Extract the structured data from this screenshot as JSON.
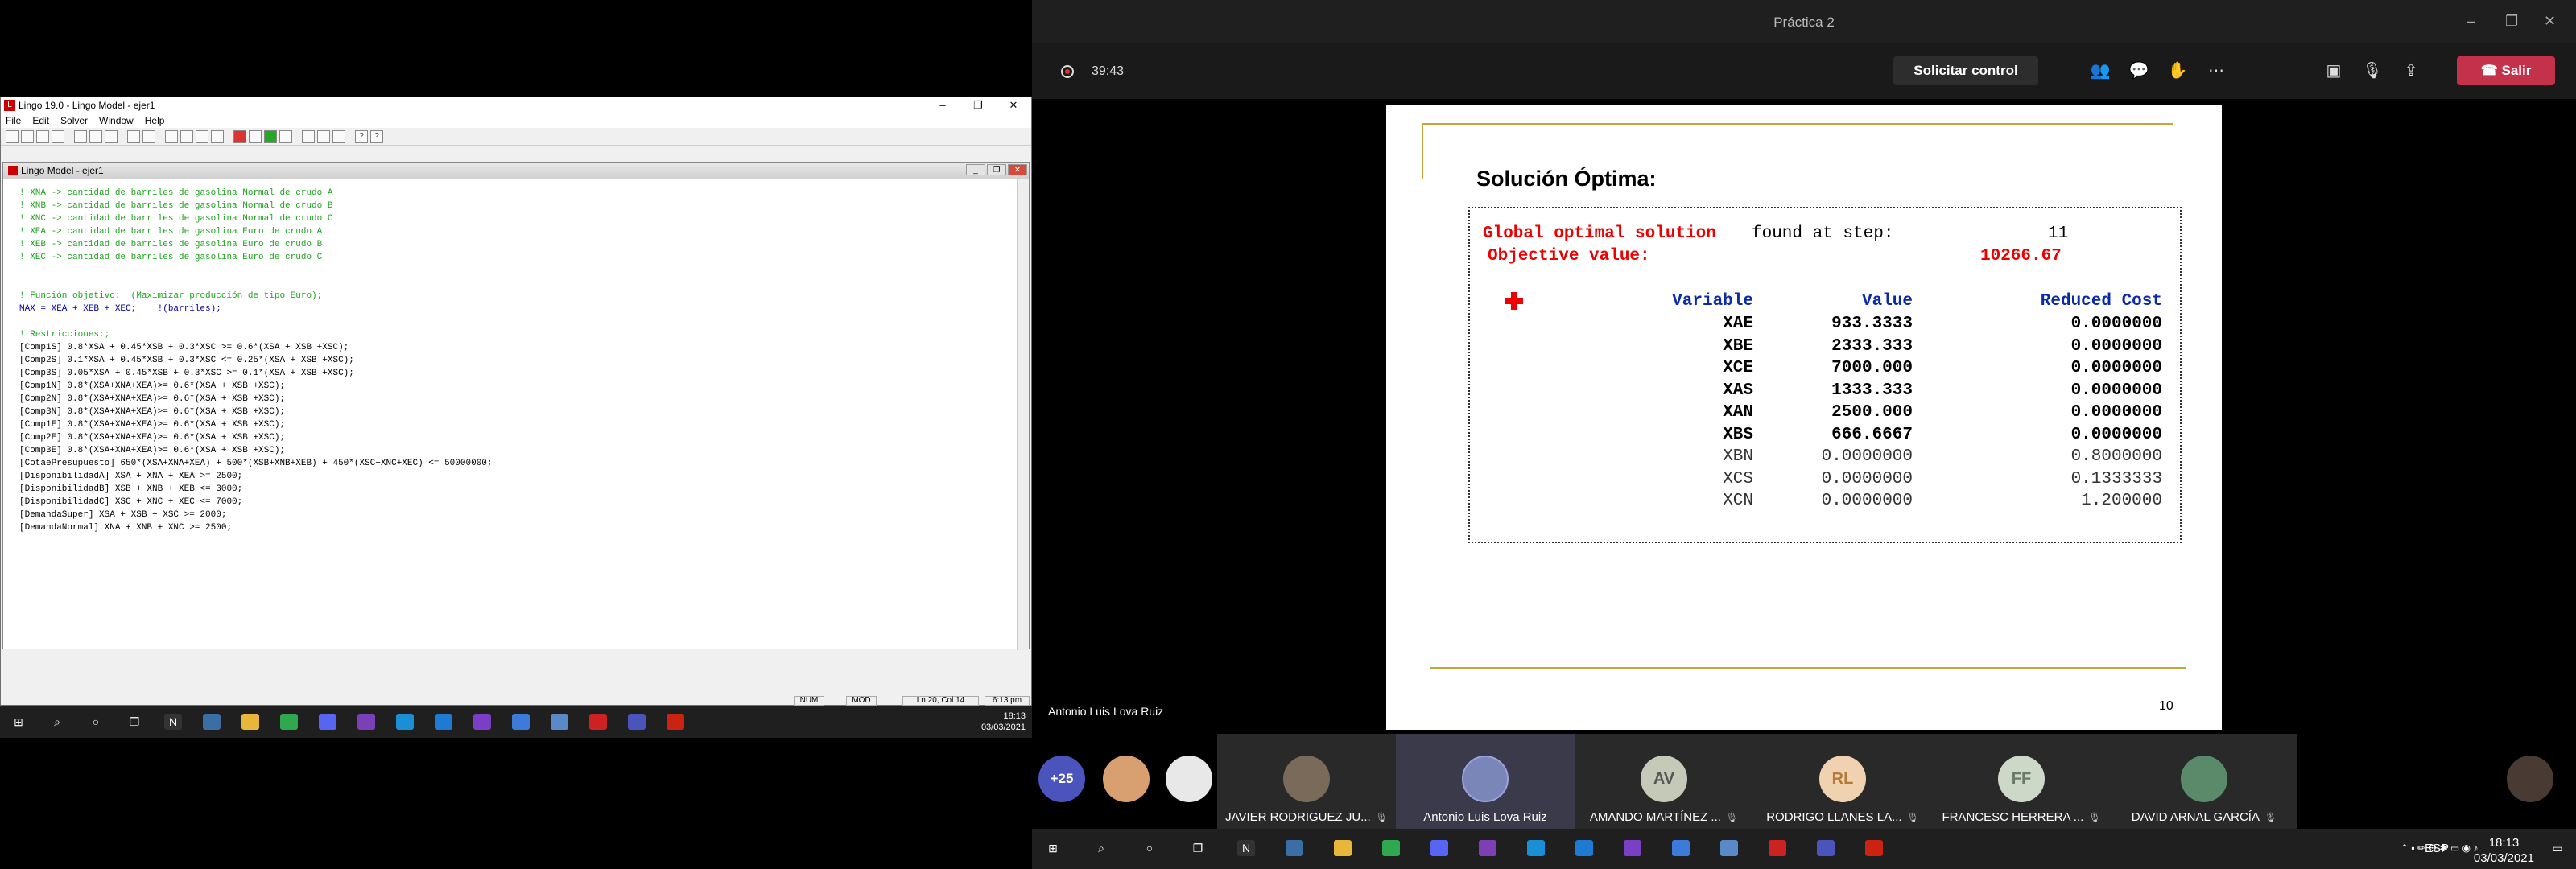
{
  "lingo": {
    "title": "Lingo 19.0 - Lingo Model - ejer1",
    "menu": [
      "File",
      "Edit",
      "Solver",
      "Window",
      "Help"
    ],
    "model_title": "Lingo Model - ejer1",
    "code_lines": [
      {
        "type": "comment",
        "text": "! XNA -> cantidad de barriles de gasolina Normal de crudo A"
      },
      {
        "type": "comment",
        "text": "! XNB -> cantidad de barriles de gasolina Normal de crudo B"
      },
      {
        "type": "comment",
        "text": "! XNC -> cantidad de barriles de gasolina Normal de crudo C"
      },
      {
        "type": "comment",
        "text": "! XEA -> cantidad de barriles de gasolina Euro de crudo A"
      },
      {
        "type": "comment",
        "text": "! XEB -> cantidad de barriles de gasolina Euro de crudo B"
      },
      {
        "type": "comment",
        "text": "! XEC -> cantidad de barriles de gasolina Euro de crudo C"
      },
      {
        "type": "blank",
        "text": ""
      },
      {
        "type": "blank",
        "text": ""
      },
      {
        "type": "comment",
        "text": "! Función objetivo:  (Maximizar producción de tipo Euro);"
      },
      {
        "type": "max",
        "text": "MAX = XEA + XEB + XEC;    !(barriles);"
      },
      {
        "type": "blank",
        "text": ""
      },
      {
        "type": "comment",
        "text": "! Restricciones:;"
      },
      {
        "type": "code",
        "text": "[Comp1S] 0.8*XSA + 0.45*XSB + 0.3*XSC >= 0.6*(XSA + XSB +XSC);"
      },
      {
        "type": "code",
        "text": "[Comp2S] 0.1*XSA + 0.45*XSB + 0.3*XSC <= 0.25*(XSA + XSB +XSC);"
      },
      {
        "type": "code",
        "text": "[Comp3S] 0.05*XSA + 0.45*XSB + 0.3*XSC >= 0.1*(XSA + XSB +XSC);"
      },
      {
        "type": "code",
        "text": "[Comp1N] 0.8*(XSA+XNA+XEA)>= 0.6*(XSA + XSB +XSC);"
      },
      {
        "type": "code",
        "text": "[Comp2N] 0.8*(XSA+XNA+XEA)>= 0.6*(XSA + XSB +XSC);"
      },
      {
        "type": "code",
        "text": "[Comp3N] 0.8*(XSA+XNA+XEA)>= 0.6*(XSA + XSB +XSC);"
      },
      {
        "type": "code",
        "text": "[Comp1E] 0.8*(XSA+XNA+XEA)>= 0.6*(XSA + XSB +XSC);"
      },
      {
        "type": "code",
        "text": "[Comp2E] 0.8*(XSA+XNA+XEA)>= 0.6*(XSA + XSB +XSC);"
      },
      {
        "type": "code",
        "text": "[Comp3E] 0.8*(XSA+XNA+XEA)>= 0.6*(XSA + XSB +XSC);"
      },
      {
        "type": "code",
        "text": "[CotaePresupuesto] 650*(XSA+XNA+XEA) + 500*(XSB+XNB+XEB) + 450*(XSC+XNC+XEC) <= 50000000;"
      },
      {
        "type": "code",
        "text": "[DisponibilidadA] XSA + XNA + XEA >= 2500;"
      },
      {
        "type": "code",
        "text": "[DisponibilidadB] XSB + XNB + XEB <= 3000;"
      },
      {
        "type": "code",
        "text": "[DisponibilidadC] XSC + XNC + XEC <= 7000;"
      },
      {
        "type": "code",
        "text": "[DemandaSuper] XSA + XSB + XSC >= 2000;"
      },
      {
        "type": "code",
        "text": "[DemandaNormal] XNA + XNB + XNC >= 2500;"
      }
    ],
    "status": {
      "num": "NUM",
      "mod": "MOD",
      "pos": "Ln 20, Col 14",
      "time": "6:13 pm"
    },
    "clock_time": "18:13",
    "clock_date": "03/03/2021"
  },
  "teams": {
    "window_title": "Práctica 2",
    "timer": "39:43",
    "request_control": "Solicitar control",
    "leave": "Salir",
    "presenter": "Antonio Luis Lova Ruiz",
    "slide": {
      "title": "Solución Óptima:",
      "line1_red": "Global optimal solution",
      "line1_rest": "found at step:",
      "line1_value": "11",
      "line2_red": "Objective value:",
      "line2_value": "10266.67",
      "headers": [
        "Variable",
        "Value",
        "Reduced Cost"
      ],
      "rows": [
        {
          "var": "XAE",
          "value": "933.3333",
          "cost": "0.0000000",
          "bold": true
        },
        {
          "var": "XBE",
          "value": "2333.333",
          "cost": "0.0000000",
          "bold": true
        },
        {
          "var": "XCE",
          "value": "7000.000",
          "cost": "0.0000000",
          "bold": true
        },
        {
          "var": "XAS",
          "value": "1333.333",
          "cost": "0.0000000",
          "bold": true
        },
        {
          "var": "XAN",
          "value": "2500.000",
          "cost": "0.0000000",
          "bold": true
        },
        {
          "var": "XBS",
          "value": "666.6667",
          "cost": "0.0000000",
          "bold": true
        },
        {
          "var": "XBN",
          "value": "0.0000000",
          "cost": "0.8000000",
          "bold": false
        },
        {
          "var": "XCS",
          "value": "0.0000000",
          "cost": "0.1333333",
          "bold": false
        },
        {
          "var": "XCN",
          "value": "0.0000000",
          "cost": "1.200000",
          "bold": false
        }
      ],
      "page_number": "10"
    },
    "participants": [
      {
        "kind": "count",
        "label": "+25"
      },
      {
        "kind": "photo",
        "name": ""
      },
      {
        "kind": "photo",
        "name": ""
      },
      {
        "kind": "tile",
        "name": "JAVIER RODRIGUEZ JU...",
        "initials": "",
        "color": "#6a5a4a"
      },
      {
        "kind": "tile",
        "name": "Antonio Luis Lova Ruiz",
        "initials": "",
        "color": "#7a86b8",
        "active": true
      },
      {
        "kind": "tile",
        "name": "AMANDO MARTÍNEZ ...",
        "initials": "AV",
        "color": "#c5c9b8"
      },
      {
        "kind": "tile",
        "name": "RODRIGO LLANES LA...",
        "initials": "RL",
        "color": "#f1d2b0"
      },
      {
        "kind": "tile",
        "name": "FRANCESC HERRERA ...",
        "initials": "FF",
        "color": "#cdd8c8"
      },
      {
        "kind": "tile",
        "name": "DAVID ARNAL GARCÍA",
        "initials": "",
        "color": "#5a8a6a"
      },
      {
        "kind": "photo-end",
        "name": ""
      }
    ],
    "taskbar": {
      "lang": "ESP",
      "time": "18:13",
      "date": "03/03/2021"
    }
  }
}
